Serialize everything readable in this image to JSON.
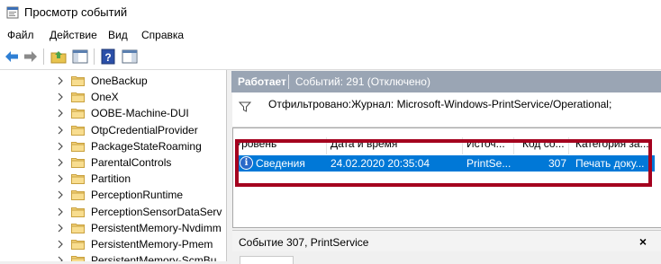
{
  "window": {
    "title": "Просмотр событий"
  },
  "menu": {
    "items": [
      "Файл",
      "Действие",
      "Вид",
      "Справка"
    ]
  },
  "toolbar": {
    "buttons": [
      "back-icon",
      "forward-icon",
      "folder-up-icon",
      "pane-icon",
      "help-icon",
      "panel-icon"
    ]
  },
  "tree": {
    "items": [
      "OneBackup",
      "OneX",
      "OOBE-Machine-DUI",
      "OtpCredentialProvider",
      "PackageStateRoaming",
      "ParentalControls",
      "Partition",
      "PerceptionRuntime",
      "PerceptionSensorDataServ",
      "PersistentMemory-Nvdimm",
      "PersistentMemory-Pmem",
      "PersistentMemory-ScmBu"
    ]
  },
  "log_header": {
    "title": "Работает",
    "count": "Событий: 291 (Отключено)"
  },
  "filter": {
    "text": "Отфильтровано:Журнал: Microsoft-Windows-PrintService/Operational;"
  },
  "grid": {
    "columns": [
      "Уровень",
      "Дата и время",
      "Источ...",
      "Код со...",
      "Категория за..."
    ],
    "selected_row": {
      "level": "Сведения",
      "datetime": "24.02.2020 20:35:04",
      "source": "PrintSe...",
      "code": "307",
      "category": "Печать доку..."
    }
  },
  "details": {
    "title": "Событие 307, PrintService",
    "close": "×"
  },
  "colors": {
    "header": "#9aa5b4",
    "selection": "#0078d7",
    "highlight": "#a4001e"
  }
}
